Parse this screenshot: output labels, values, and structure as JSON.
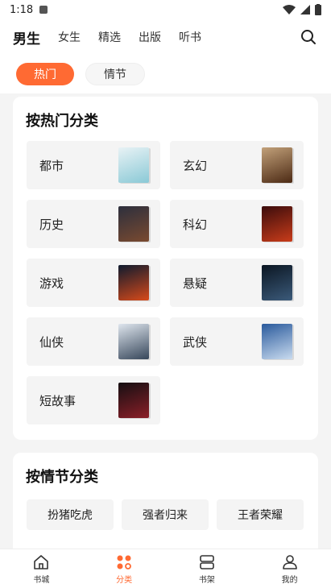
{
  "status": {
    "time": "1:18"
  },
  "header": {
    "tabs": [
      {
        "label": "男生",
        "active": true
      },
      {
        "label": "女生",
        "active": false
      },
      {
        "label": "精选",
        "active": false
      },
      {
        "label": "出版",
        "active": false
      },
      {
        "label": "听书",
        "active": false
      }
    ]
  },
  "filters": [
    {
      "label": "热门",
      "active": true
    },
    {
      "label": "情节",
      "active": false
    }
  ],
  "hot": {
    "title": "按热门分类",
    "categories": [
      {
        "label": "都市",
        "cover_colors": [
          "#e8f2f5",
          "#8ac9d6"
        ]
      },
      {
        "label": "玄幻",
        "cover_colors": [
          "#c2a17a",
          "#4c2a14"
        ]
      },
      {
        "label": "历史",
        "cover_colors": [
          "#2c2f3d",
          "#7a4a30"
        ]
      },
      {
        "label": "科幻",
        "cover_colors": [
          "#3b0c0c",
          "#c93c1a"
        ]
      },
      {
        "label": "游戏",
        "cover_colors": [
          "#0e1a2e",
          "#d84a1a"
        ]
      },
      {
        "label": "悬疑",
        "cover_colors": [
          "#0b1622",
          "#3b5a7a"
        ]
      },
      {
        "label": "仙侠",
        "cover_colors": [
          "#dfe6ee",
          "#36465a"
        ]
      },
      {
        "label": "武侠",
        "cover_colors": [
          "#2a5a9c",
          "#c9dbef"
        ]
      },
      {
        "label": "短故事",
        "cover_colors": [
          "#150f12",
          "#8b1f28"
        ]
      }
    ]
  },
  "plot": {
    "title": "按情节分类",
    "tags": [
      "扮猪吃虎",
      "强者归来",
      "王者荣耀"
    ]
  },
  "nav": [
    {
      "label": "书城",
      "icon": "home-icon",
      "active": false
    },
    {
      "label": "分类",
      "icon": "category-icon",
      "active": true
    },
    {
      "label": "书架",
      "icon": "bookshelf-icon",
      "active": false
    },
    {
      "label": "我的",
      "icon": "profile-icon",
      "active": false
    }
  ],
  "colors": {
    "accent": "#ff6a33"
  }
}
